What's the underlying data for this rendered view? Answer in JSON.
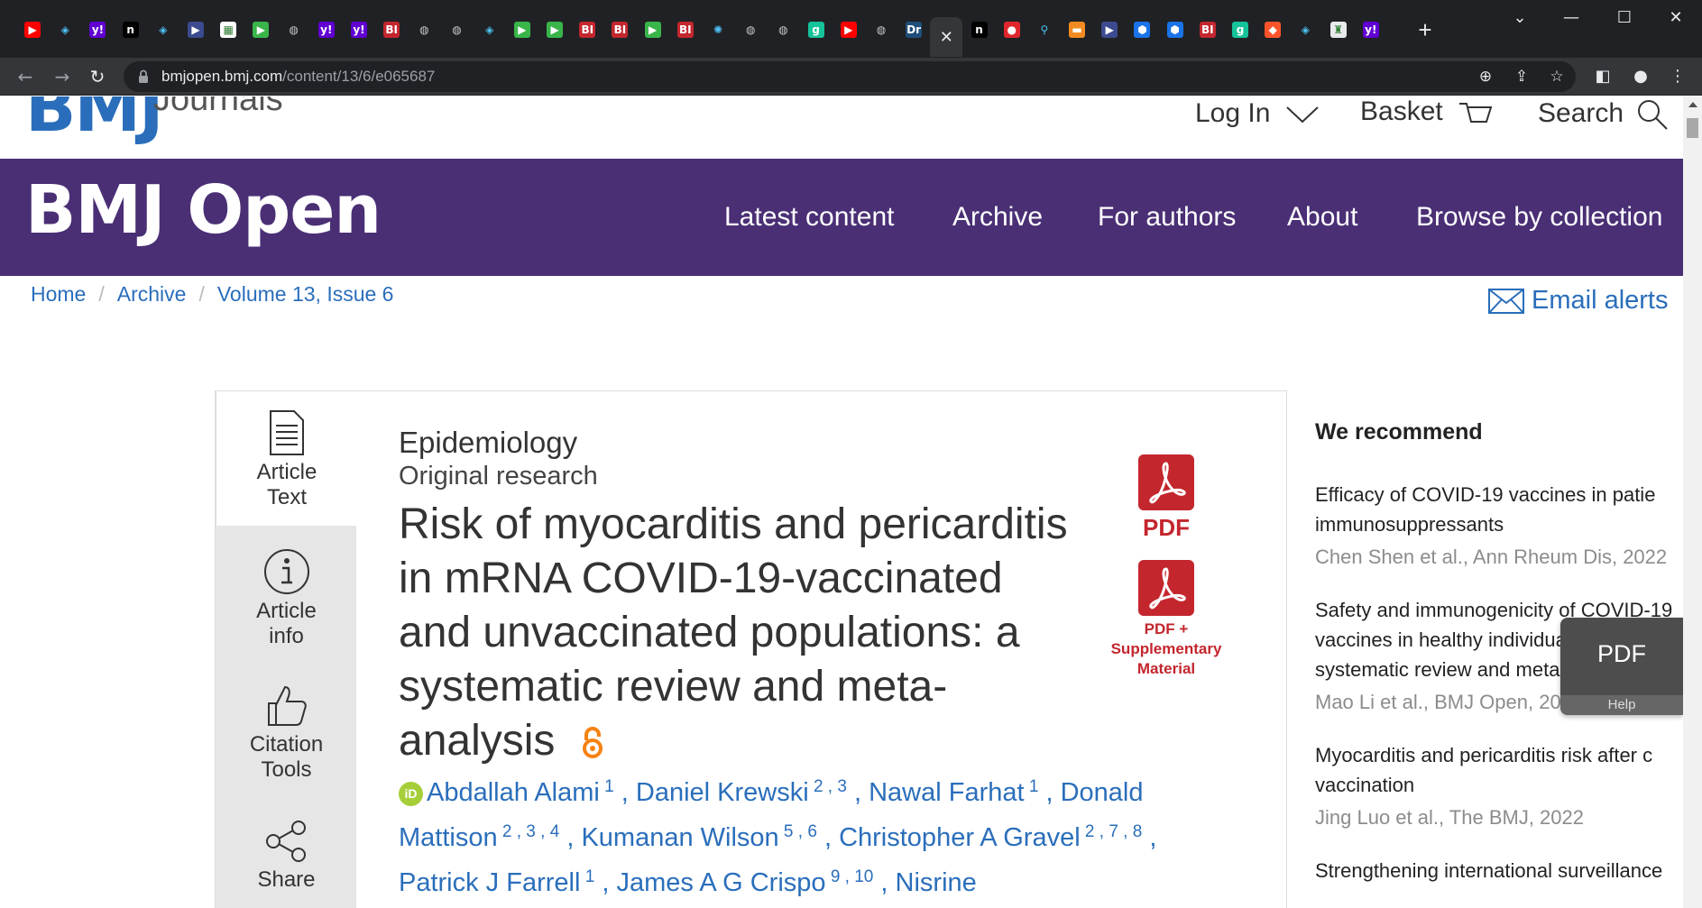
{
  "browser": {
    "tabs": [
      {
        "icon": "youtube-icon",
        "color": "#ff0000",
        "glyph": "▶"
      },
      {
        "icon": "shield-icon",
        "color": "#202124",
        "glyph": "◈"
      },
      {
        "icon": "yahoo-icon",
        "color": "#6001d2",
        "glyph": "y!"
      },
      {
        "icon": "notion-icon",
        "color": "#000000",
        "glyph": "n"
      },
      {
        "icon": "shield-icon",
        "color": "#202124",
        "glyph": "◈"
      },
      {
        "icon": "arrow-icon",
        "color": "#3c4a8f",
        "glyph": "▶"
      },
      {
        "icon": "grid-icon",
        "color": "#ffffff",
        "glyph": "▦"
      },
      {
        "icon": "play-icon",
        "color": "#39b54a",
        "glyph": "▶"
      },
      {
        "icon": "globe-icon",
        "color": "#5f6368",
        "glyph": "◍"
      },
      {
        "icon": "yahoo-icon",
        "color": "#6001d2",
        "glyph": "y!"
      },
      {
        "icon": "yahoo-icon",
        "color": "#6001d2",
        "glyph": "y!"
      },
      {
        "icon": "bi-icon",
        "color": "#c4262e",
        "glyph": "BI"
      },
      {
        "icon": "globe-icon",
        "color": "#5f6368",
        "glyph": "◍"
      },
      {
        "icon": "globe-icon",
        "color": "#5f6368",
        "glyph": "◍"
      },
      {
        "icon": "shield-icon",
        "color": "#202124",
        "glyph": "◈"
      },
      {
        "icon": "play-icon",
        "color": "#39b54a",
        "glyph": "▶"
      },
      {
        "icon": "play-icon",
        "color": "#39b54a",
        "glyph": "▶"
      },
      {
        "icon": "bi-icon",
        "color": "#c4262e",
        "glyph": "BI"
      },
      {
        "icon": "bi-icon",
        "color": "#c4262e",
        "glyph": "BI"
      },
      {
        "icon": "play-icon",
        "color": "#39b54a",
        "glyph": "▶"
      },
      {
        "icon": "bi-icon",
        "color": "#c4262e",
        "glyph": "BI"
      },
      {
        "icon": "burst-icon",
        "color": "#202124",
        "glyph": "✺"
      },
      {
        "icon": "globe-icon",
        "color": "#5f6368",
        "glyph": "◍"
      },
      {
        "icon": "globe-icon",
        "color": "#5f6368",
        "glyph": "◍"
      },
      {
        "icon": "grammarly-icon",
        "color": "#15c39a",
        "glyph": "g"
      },
      {
        "icon": "youtube-icon",
        "color": "#ff0000",
        "glyph": "▶"
      },
      {
        "icon": "globe-icon",
        "color": "#5f6368",
        "glyph": "◍"
      },
      {
        "icon": "dr-icon",
        "color": "#1f4e79",
        "glyph": "Dr"
      },
      {
        "icon": "close-icon",
        "color": "#35363a",
        "glyph": "✕",
        "active": true
      },
      {
        "icon": "notion-icon",
        "color": "#000000",
        "glyph": "n"
      },
      {
        "icon": "mic-icon",
        "color": "#e0262c",
        "glyph": "●"
      },
      {
        "icon": "search-icon",
        "color": "#202124",
        "glyph": "⚲"
      },
      {
        "icon": "bookmark-icon",
        "color": "#f28b22",
        "glyph": "▬"
      },
      {
        "icon": "arrow-icon",
        "color": "#3c4a8f",
        "glyph": "▶"
      },
      {
        "icon": "cube-icon",
        "color": "#1a73e8",
        "glyph": "⬢"
      },
      {
        "icon": "cube-icon",
        "color": "#1a73e8",
        "glyph": "⬢"
      },
      {
        "icon": "bi-icon",
        "color": "#c4262e",
        "glyph": "BI"
      },
      {
        "icon": "grammarly-icon",
        "color": "#15c39a",
        "glyph": "g"
      },
      {
        "icon": "brave-icon",
        "color": "#fb542b",
        "glyph": "◆"
      },
      {
        "icon": "shield-icon",
        "color": "#202124",
        "glyph": "◈"
      },
      {
        "icon": "crest-icon",
        "color": "#e8eaed",
        "glyph": "♜"
      },
      {
        "icon": "yahoo-icon",
        "color": "#6001d2",
        "glyph": "y!"
      }
    ],
    "url_domain": "bmjopen.bmj.com",
    "url_path": "/content/13/6/e065687"
  },
  "site": {
    "logo": "BMJ",
    "logo_sub": "Journals",
    "login": "Log In",
    "basket": "Basket",
    "search": "Search",
    "journal_title": "BMJ Open",
    "nav": [
      "Latest content",
      "Archive",
      "For authors",
      "About",
      "Browse by collection"
    ]
  },
  "breadcrumb": [
    "Home",
    "Archive",
    "Volume 13, Issue 6"
  ],
  "email_alerts": "Email alerts",
  "tools": {
    "article_text": [
      "Article",
      "Text"
    ],
    "article_info": [
      "Article",
      "info"
    ],
    "citation": [
      "Citation",
      "Tools"
    ],
    "share": "Share"
  },
  "article": {
    "subject": "Epidemiology",
    "type": "Original research",
    "title": "Risk of myocarditis and pericarditis in mRNA COVID-19-vaccinated and unvaccinated populations: a systematic review and meta-analysis",
    "pdf_label": "PDF",
    "pdf_supp_label": [
      "PDF +",
      "Supplementary",
      "Material"
    ],
    "authors": [
      {
        "name": "Abdallah Alami",
        "sup": "1",
        "orcid": true
      },
      {
        "name": "Daniel Krewski",
        "sup": "2 , 3"
      },
      {
        "name": "Nawal Farhat",
        "sup": "1"
      },
      {
        "name": "Donald Mattison",
        "sup": "2 , 3 , 4"
      },
      {
        "name": "Kumanan Wilson",
        "sup": "5 , 6"
      },
      {
        "name": "Christopher A Gravel",
        "sup": "2 , 7 , 8"
      },
      {
        "name": "Patrick J Farrell",
        "sup": "1"
      },
      {
        "name": "James A G Crispo",
        "sup": "9 , 10"
      },
      {
        "name": "Nisrine"
      }
    ]
  },
  "sidebar": {
    "heading": "We recommend",
    "items": [
      {
        "title": [
          "Efficacy of COVID-19 vaccines in patie",
          "immunosuppressants"
        ],
        "source": "Chen Shen et al., Ann Rheum Dis, 2022"
      },
      {
        "title": [
          "Safety and immunogenicity of COVID-19",
          "vaccines in healthy individuals: a",
          "systematic review and meta-analysis"
        ],
        "source": "Mao Li et al., BMJ Open, 2021"
      },
      {
        "title": [
          "Myocarditis and pericarditis risk after c",
          "vaccination"
        ],
        "source": "Jing Luo et al., The BMJ, 2022"
      },
      {
        "title": [
          "Strengthening international surveillance"
        ],
        "source": ""
      }
    ]
  },
  "pdf_float": {
    "label": "PDF",
    "help": "Help"
  }
}
